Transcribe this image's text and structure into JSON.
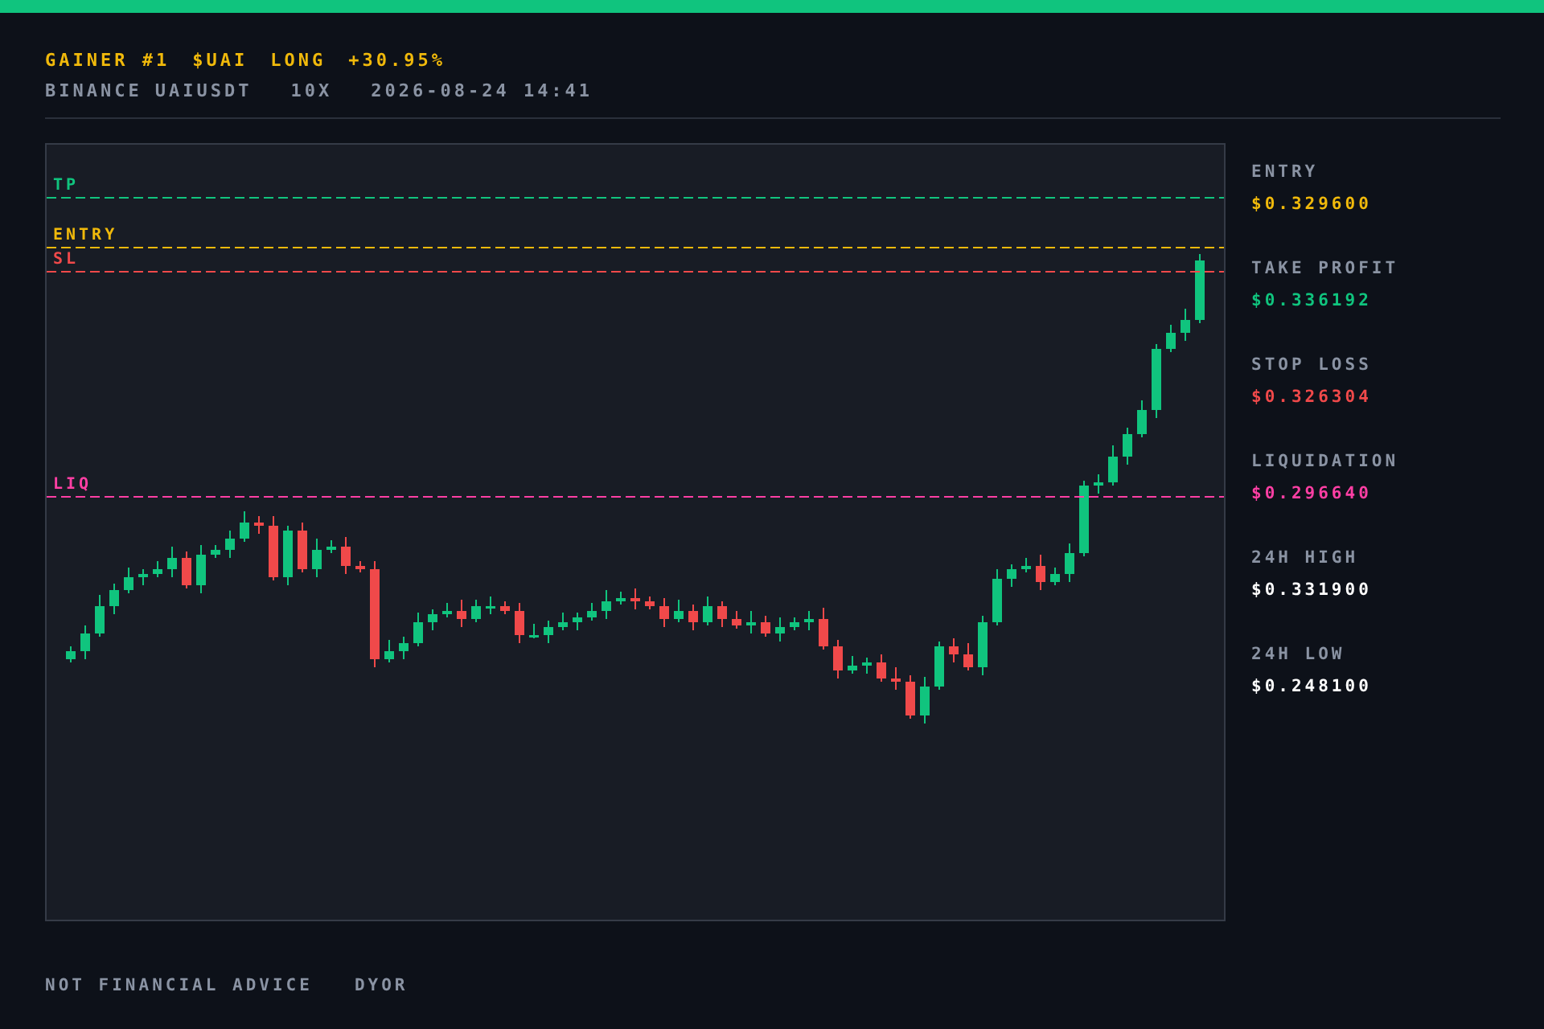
{
  "header": {
    "rank": "GAINER #1",
    "ticker": "$UAI",
    "side": "LONG",
    "change": "+30.95%"
  },
  "subheader": {
    "exchange": "BINANCE",
    "pair": "UAIUSDT",
    "leverage": "10X",
    "timestamp": "2026-08-24 14:41"
  },
  "chart": {
    "levels": [
      {
        "kind": "tp",
        "label": "TP",
        "color": "#10c47e"
      },
      {
        "kind": "entry",
        "label": "ENTRY",
        "color": "#f0b90b"
      },
      {
        "kind": "sl",
        "label": "SL",
        "color": "#f0494a"
      },
      {
        "kind": "liq",
        "label": "LIQ",
        "color": "#ff3fa4"
      }
    ]
  },
  "stats": [
    {
      "label": "ENTRY",
      "value": "$0.329600",
      "color": "#f0b90b"
    },
    {
      "label": "TAKE PROFIT",
      "value": "$0.336192",
      "color": "#10c47e"
    },
    {
      "label": "STOP LOSS",
      "value": "$0.326304",
      "color": "#f0494a"
    },
    {
      "label": "LIQUIDATION",
      "value": "$0.296640",
      "color": "#ff3fa4"
    },
    {
      "label": "24H HIGH",
      "value": "$0.331900",
      "color": "#ffffff"
    },
    {
      "label": "24H LOW",
      "value": "$0.248100",
      "color": "#ffffff"
    }
  ],
  "footer": [
    "NOT FINANCIAL ADVICE",
    "DYOR"
  ]
}
